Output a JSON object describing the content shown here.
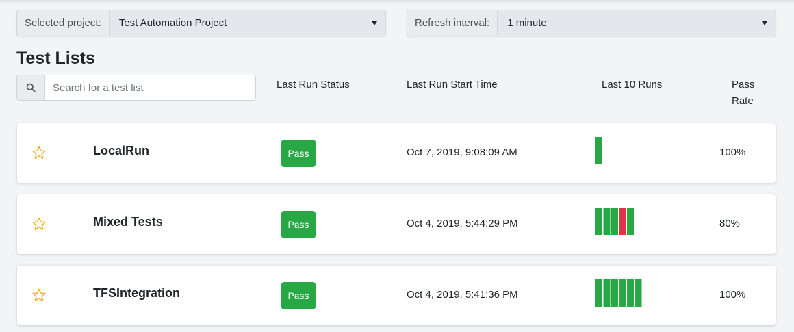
{
  "project_selector": {
    "label": "Selected project:",
    "value": "Test Automation Project"
  },
  "refresh_selector": {
    "label": "Refresh interval:",
    "value": "1 minute"
  },
  "heading": "Test Lists",
  "search": {
    "placeholder": "Search for a test list"
  },
  "columns": {
    "status": "Last Run Status",
    "start_time": "Last Run Start Time",
    "last_runs": "Last 10 Runs",
    "pass_rate_line1": "Pass",
    "pass_rate_line2": "Rate"
  },
  "colors": {
    "pass": "#28a745",
    "fail": "#dc3545",
    "star": "#f0b429"
  },
  "test_lists": [
    {
      "name": "LocalRun",
      "status": "Pass",
      "start_time": "Oct 7, 2019, 9:08:09 AM",
      "runs": [
        "pass"
      ],
      "pass_rate": "100%"
    },
    {
      "name": "Mixed Tests",
      "status": "Pass",
      "start_time": "Oct 4, 2019, 5:44:29 PM",
      "runs": [
        "pass",
        "pass",
        "pass",
        "fail",
        "pass"
      ],
      "pass_rate": "80%"
    },
    {
      "name": "TFSIntegration",
      "status": "Pass",
      "start_time": "Oct 4, 2019, 5:41:36 PM",
      "runs": [
        "pass",
        "pass",
        "pass",
        "pass",
        "pass",
        "pass"
      ],
      "pass_rate": "100%"
    }
  ]
}
